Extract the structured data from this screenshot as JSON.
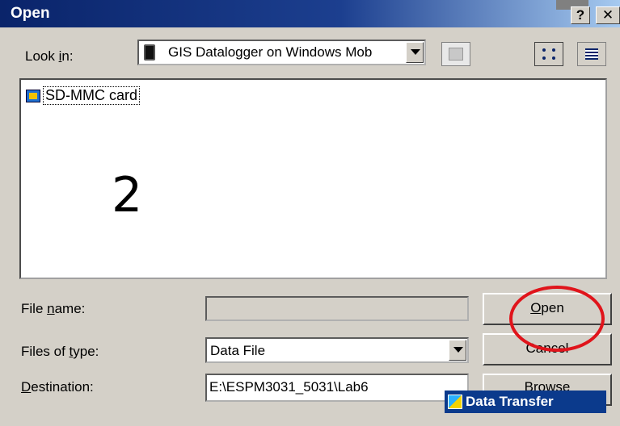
{
  "window": {
    "title": "Open",
    "help_label": "?",
    "close_label": "✕"
  },
  "look_in": {
    "label_pre": "Look ",
    "label_key": "i",
    "label_post": "n:",
    "value": "GIS Datalogger on Windows Mob"
  },
  "files": [
    {
      "name": "SD-MMC card",
      "icon": "memory-card-icon"
    }
  ],
  "annotation_number": "2",
  "file_name": {
    "label_pre": "File ",
    "label_key": "n",
    "label_post": "ame:",
    "value": ""
  },
  "files_of_type": {
    "label_pre": "Files of ",
    "label_key": "t",
    "label_post": "ype:",
    "value": "Data File"
  },
  "destination": {
    "label_key": "D",
    "label_post": "estination:",
    "value": "E:\\ESPM3031_5031\\Lab6"
  },
  "buttons": {
    "open_key": "O",
    "open_rest": "pen",
    "cancel": "Cancel",
    "browse": "Browse"
  },
  "data_transfer": "Data Transfer",
  "colors": {
    "titlebar": "#0a246a",
    "highlight_circle": "#e0141b"
  }
}
